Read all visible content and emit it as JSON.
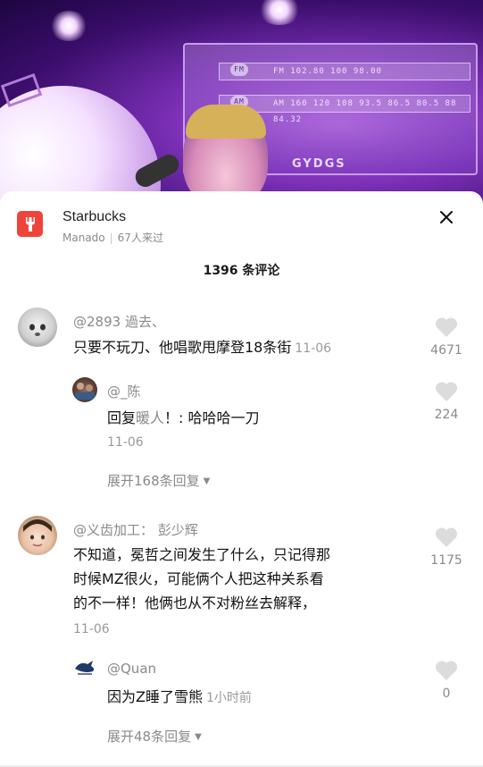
{
  "video": {
    "screen_bands": [
      "FM 102.80 100 98.00",
      "AM 160 120 108 93.5 86.5 80.5 88 84.32"
    ],
    "brand_text": "GYDGS"
  },
  "poi": {
    "name": "Starbucks",
    "location": "Manado",
    "separator": "|",
    "visitors": "67人来过",
    "icon": "fork-icon",
    "icon_color": "#f0443b"
  },
  "comments_header": "1396 条评论",
  "comments": [
    {
      "user": "@2893 過去、",
      "text": "只要不玩刀、他唱歌甩摩登18条街",
      "time": "11-06",
      "likes": "4671",
      "replies": [
        {
          "user": "@_陈",
          "prefix": "回复",
          "target": "暖人",
          "text": "！: 哈哈哈一刀",
          "time": "11-06",
          "likes": "224"
        }
      ],
      "expand_label": "展开168条回复"
    },
    {
      "user": "@义齿加工：  彭少辉",
      "text_lines": [
        "不知道，冕哲之间发生了什么，只记得那",
        "时候MZ很火，可能俩个人把这种关系看",
        "的不一样！他俩也从不对粉丝去解释，"
      ],
      "time": "11-06",
      "likes": "1175",
      "replies": [
        {
          "user": "@Quan",
          "text": "因为Z睡了雪熊",
          "time": "1小时前",
          "likes": "0"
        }
      ],
      "expand_label": "展开48条回复"
    }
  ],
  "colors": {
    "like_gray": "#dcdcdc",
    "meta_gray": "#8a8a8a"
  }
}
